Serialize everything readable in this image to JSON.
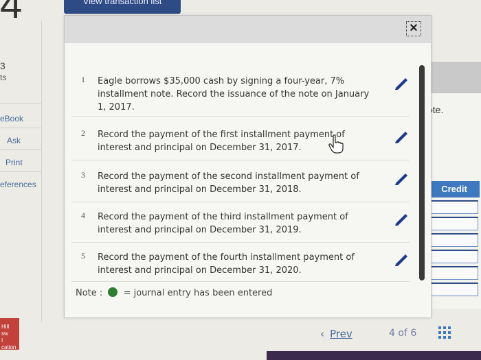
{
  "sidebar": {
    "question_number": "4",
    "points_number": "3",
    "points_label": "ts",
    "links": [
      "eBook",
      "Ask",
      "Print",
      "eferences"
    ]
  },
  "top_button": {
    "label": "View transaction list"
  },
  "modal": {
    "close_glyph": "✕",
    "rows": [
      {
        "num": "1",
        "text": "Eagle borrows $35,000 cash by signing a four-year, 7% installment note. Record the issuance of the note on January 1, 2017."
      },
      {
        "num": "2",
        "text": "Record the payment of the first installment payment of interest and principal on December 31, 2017."
      },
      {
        "num": "3",
        "text": "Record the payment of the second installment payment of interest and principal on December 31, 2018."
      },
      {
        "num": "4",
        "text": "Record the payment of the third installment payment of interest and principal on December 31, 2019."
      },
      {
        "num": "5",
        "text": "Record the payment of the fourth installment payment of interest and principal on December 31, 2020."
      }
    ],
    "note": {
      "prefix": "Note :",
      "suffix": "= journal entry has been entered"
    }
  },
  "right_panel": {
    "note_fragment": "ote.",
    "credit_header": "Credit"
  },
  "navigation": {
    "prev_arrow": "‹",
    "prev_label": "Prev",
    "page_current": "4",
    "page_of": "of",
    "page_total": "6"
  },
  "colors": {
    "accent_blue": "#2f4b86",
    "credit_blue": "#3e78bf",
    "entered_green": "#2e7d32"
  }
}
